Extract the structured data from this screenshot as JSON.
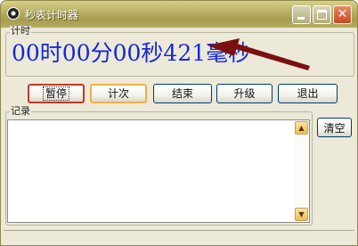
{
  "window": {
    "title": "秒表计时器",
    "close_symbol": "✕"
  },
  "timer": {
    "group_label": "计时",
    "display": "00时00分00秒421毫秒"
  },
  "buttons": {
    "pause": "暂停",
    "lap": "计次",
    "end": "结束",
    "upgrade": "升级",
    "exit": "退出",
    "clear": "清空"
  },
  "records": {
    "group_label": "记录",
    "items": []
  },
  "scrollbar": {
    "up_symbol": "▲",
    "down_symbol": "▼"
  },
  "colors": {
    "timer_text": "#1428d8",
    "annotation_arrow": "#7a1010",
    "pause_border": "#c0392b",
    "lap_border": "#f0b04a"
  }
}
